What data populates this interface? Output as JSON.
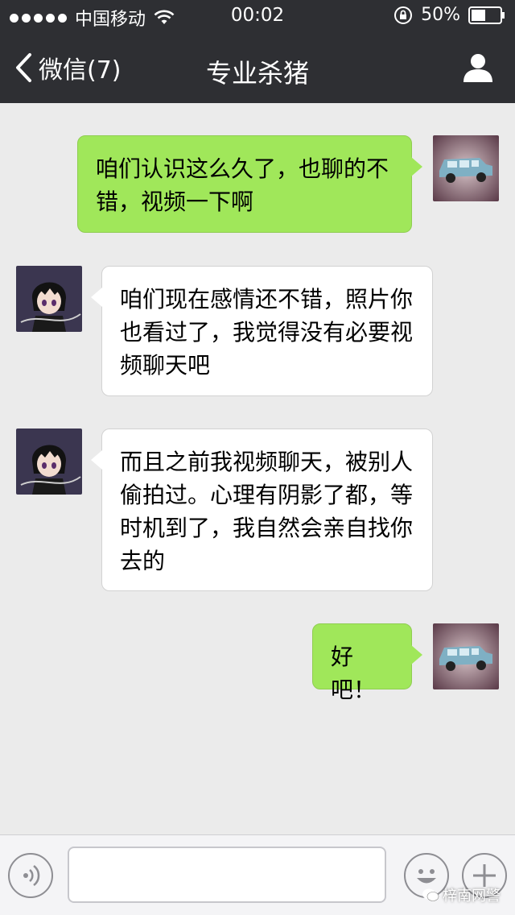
{
  "status_bar": {
    "carrier": "中国移动",
    "time": "00:02",
    "battery": "50%",
    "battery_level": 0.5
  },
  "nav": {
    "back_label": "微信(7)",
    "title": "专业杀猪"
  },
  "messages": [
    {
      "direction": "out",
      "text": "咱们认识这么久了，也聊的不错，视频一下啊"
    },
    {
      "direction": "in",
      "text": "咱们现在感情还不错，照片你也看过了，我觉得没有必要视频聊天吧"
    },
    {
      "direction": "in",
      "text": "而且之前我视频聊天，被别人偷拍过。心理有阴影了都，等时机到了，我自然会亲自找你去的"
    },
    {
      "direction": "out",
      "text": "好吧！"
    }
  ],
  "input_bar": {
    "text_value": ""
  },
  "watermark": "梓南网警",
  "colors": {
    "nav_bg": "#2e2f33",
    "chat_bg": "#ebebeb",
    "outgoing_bubble": "#a0e75a",
    "incoming_bubble": "#ffffff"
  },
  "icons": {
    "back": "chevron-left-icon",
    "profile": "person-icon",
    "voice": "voice-icon",
    "emoji": "smiley-icon",
    "plus": "plus-icon",
    "wifi": "wifi-icon",
    "lock": "rotation-lock-icon",
    "battery": "battery-icon"
  }
}
